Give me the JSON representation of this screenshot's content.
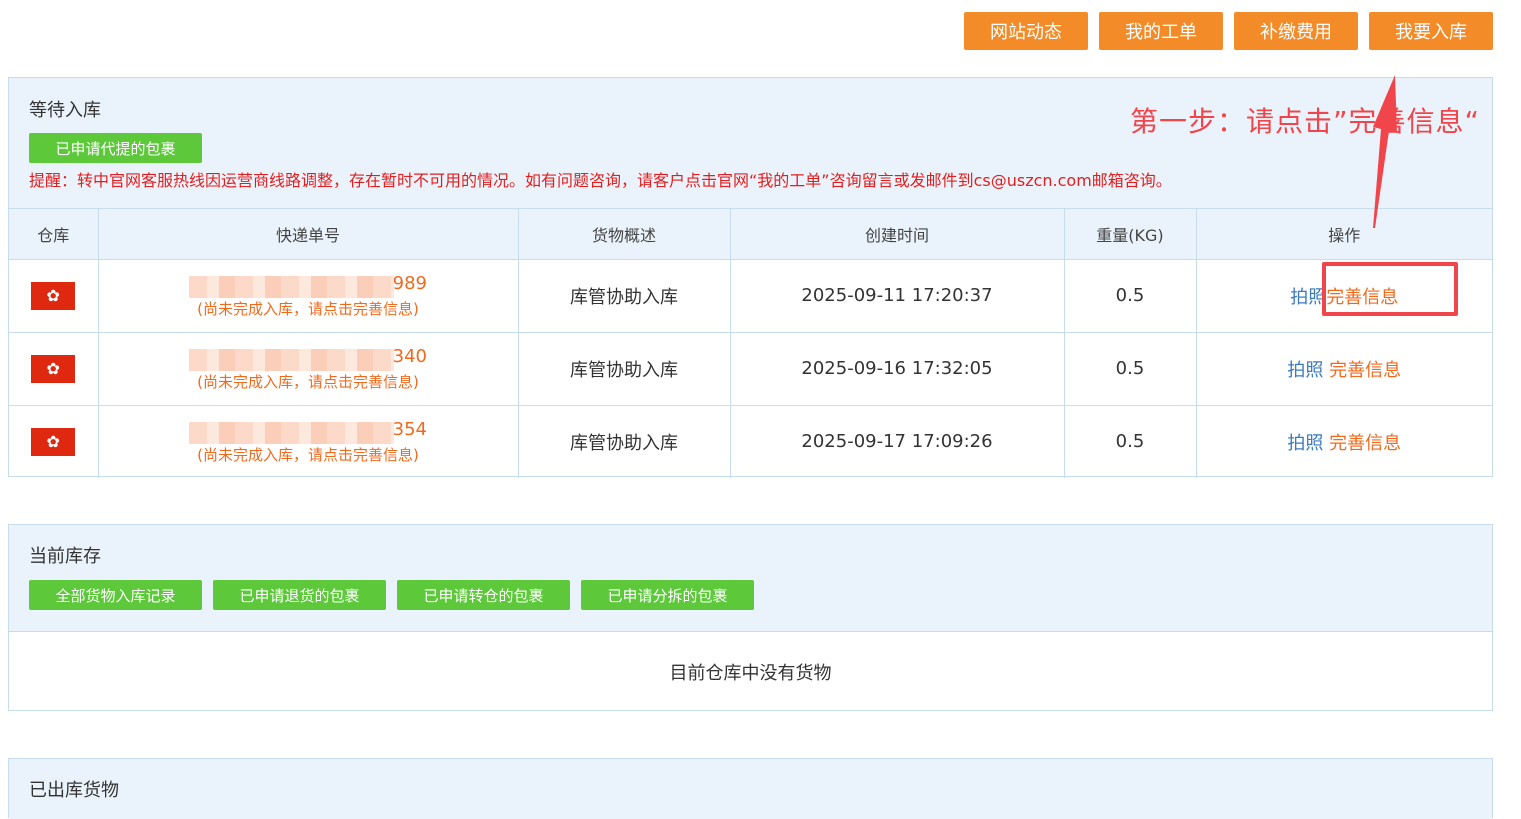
{
  "top_buttons": [
    "网站动态",
    "我的工单",
    "补缴费用",
    "我要入库"
  ],
  "pending": {
    "title": "等待入库",
    "applied_button": "已申请代提的包裹",
    "notice": "提醒：转中官网客服热线因运营商线路调整，存在暂时不可用的情况。如有问题咨询，请客户点击官网“我的工单”咨询留言或发邮件到cs@uszcn.com邮箱咨询。",
    "step_annotation": "第一步：请点击”完善信息“",
    "columns": [
      "仓库",
      "快递单号",
      "货物概述",
      "创建时间",
      "重量(KG)",
      "操作"
    ],
    "rows": [
      {
        "tracking_suffix": "989",
        "hint": "(尚未完成入库，请点击完善信息)",
        "desc": "库管协助入库",
        "created": "2025-09-11 17:20:37",
        "weight": "0.5",
        "photo": "拍照",
        "complete": "完善信息"
      },
      {
        "tracking_suffix": "340",
        "hint": "(尚未完成入库，请点击完善信息)",
        "desc": "库管协助入库",
        "created": "2025-09-16 17:32:05",
        "weight": "0.5",
        "photo": "拍照",
        "complete": "完善信息"
      },
      {
        "tracking_suffix": "354",
        "hint": "(尚未完成入库，请点击完善信息)",
        "desc": "库管协助入库",
        "created": "2025-09-17 17:09:26",
        "weight": "0.5",
        "photo": "拍照",
        "complete": "完善信息"
      }
    ]
  },
  "stock": {
    "title": "当前库存",
    "buttons": [
      "全部货物入库记录",
      "已申请退货的包裹",
      "已申请转仓的包裹",
      "已申请分拆的包裹"
    ],
    "empty_text": "目前仓库中没有货物"
  },
  "shipped": {
    "title": "已出库货物"
  },
  "colors": {
    "orange": "#f28b28",
    "green": "#5cc83a",
    "red": "#f0454a",
    "link_blue": "#3a7bbf",
    "panel_bg": "#eaf3fb"
  },
  "icons": {
    "warehouse_flag": "hong-kong-flag-icon",
    "annotation_arrow": "arrow-up-icon"
  }
}
